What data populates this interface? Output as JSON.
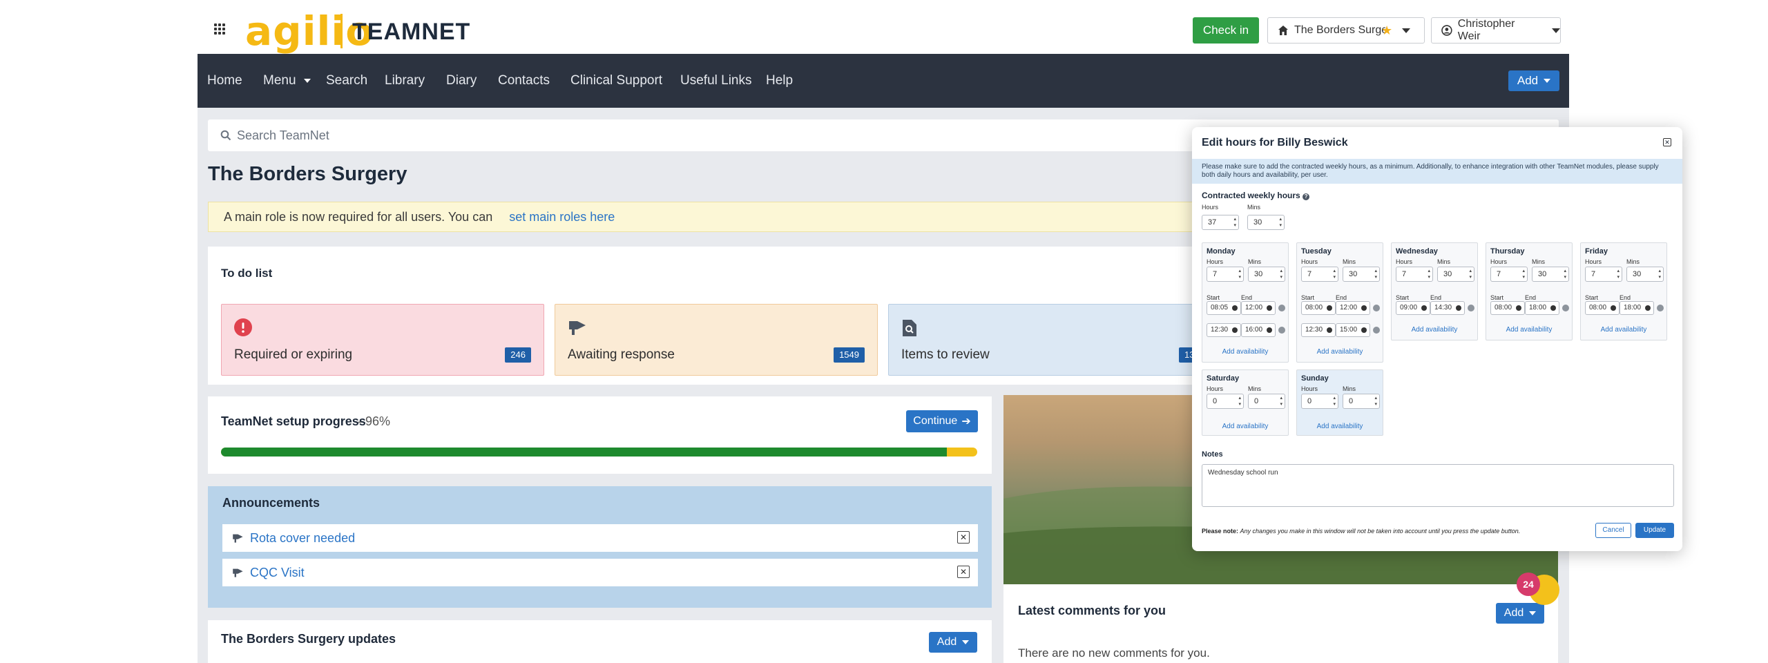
{
  "header": {
    "logo_brand": "agilio",
    "logo_product": "TEAMNET",
    "check_in": "Check in",
    "site": "The Borders Surgery",
    "user": "Christopher Weir"
  },
  "nav": {
    "items": [
      "Home",
      "Menu",
      "Search",
      "Library",
      "Diary",
      "Contacts",
      "Clinical Support",
      "Useful Links",
      "Help"
    ],
    "add": "Add"
  },
  "search": {
    "placeholder": "Search TeamNet"
  },
  "page": {
    "title": "The Borders Surgery",
    "notice_text": "A main role is now required for all users. You can",
    "notice_link": "set main roles here"
  },
  "todo": {
    "title": "To do list",
    "cards": [
      {
        "label": "Required or expiring",
        "count": "246",
        "color": "#fadbe0",
        "border": "#f0a6b2"
      },
      {
        "label": "Awaiting response",
        "count": "1549",
        "color": "#fbebd5",
        "border": "#f0c99a"
      },
      {
        "label": "Items to review",
        "count": "13",
        "color": "#dce8f4",
        "border": "#b7cde3"
      }
    ]
  },
  "setup": {
    "title": "TeamNet setup progress",
    "percent_label": "- 96%",
    "percent": 96,
    "continue": "Continue"
  },
  "announcements": {
    "title": "Announcements",
    "items": [
      "Rota cover needed",
      "CQC Visit"
    ]
  },
  "updates": {
    "title": "The Borders Surgery updates",
    "add": "Add"
  },
  "comments": {
    "title": "Latest comments for you",
    "empty": "There are no new comments for you.",
    "add": "Add",
    "badge": "24"
  },
  "modal": {
    "title": "Edit hours for Billy Beswick",
    "info": "Please make sure to add the contracted weekly hours, as a minimum. Additionally, to enhance integration with other TeamNet modules, please supply both daily hours and availability, per user.",
    "contracted_title": "Contracted weekly hours",
    "hours_label": "Hours",
    "mins_label": "Mins",
    "start_label": "Start",
    "end_label": "End",
    "contracted_hours": "37",
    "contracted_mins": "30",
    "add_availability": "Add availability",
    "days": [
      {
        "name": "Monday",
        "hours": "7",
        "mins": "30",
        "slots": [
          [
            "08:05",
            "12:00"
          ],
          [
            "12:30",
            "16:00"
          ]
        ]
      },
      {
        "name": "Tuesday",
        "hours": "7",
        "mins": "30",
        "slots": [
          [
            "08:00",
            "12:00"
          ],
          [
            "12:30",
            "15:00"
          ]
        ]
      },
      {
        "name": "Wednesday",
        "hours": "7",
        "mins": "30",
        "slots": [
          [
            "09:00",
            "14:30"
          ]
        ]
      },
      {
        "name": "Thursday",
        "hours": "7",
        "mins": "30",
        "slots": [
          [
            "08:00",
            "18:00"
          ]
        ]
      },
      {
        "name": "Friday",
        "hours": "7",
        "mins": "30",
        "slots": [
          [
            "08:00",
            "18:00"
          ]
        ]
      },
      {
        "name": "Saturday",
        "hours": "0",
        "mins": "0",
        "slots": []
      },
      {
        "name": "Sunday",
        "hours": "0",
        "mins": "0",
        "slots": []
      }
    ],
    "notes_title": "Notes",
    "notes": "Wednesday school run",
    "footer_prefix": "Please note:",
    "footer_text": "Any changes you make in this window will not be taken into account until you press the update button.",
    "cancel": "Cancel",
    "update": "Update"
  }
}
